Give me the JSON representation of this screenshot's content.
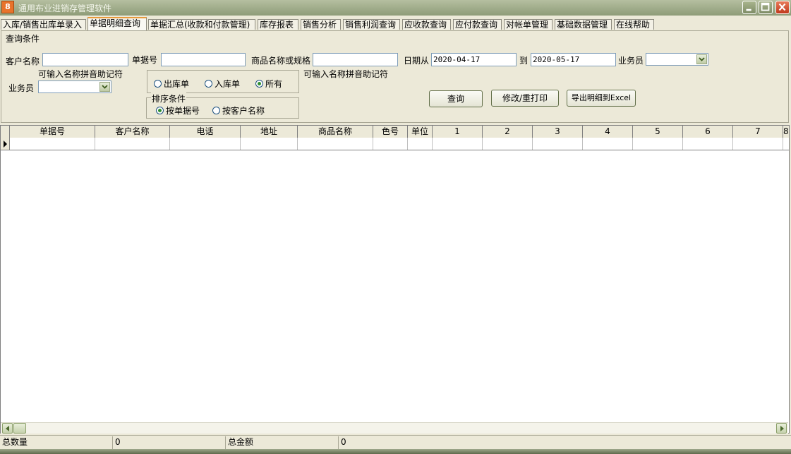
{
  "window": {
    "app_icon": "8",
    "title": "通用布业进销存管理软件"
  },
  "tabs": [
    {
      "label": "入库/销售出库单录入"
    },
    {
      "label": "单据明细查询"
    },
    {
      "label": "单据汇总(收款和付款管理)"
    },
    {
      "label": "库存报表"
    },
    {
      "label": "销售分析"
    },
    {
      "label": "销售利润查询"
    },
    {
      "label": "应收款查询"
    },
    {
      "label": "应付款查询"
    },
    {
      "label": "对帐单管理"
    },
    {
      "label": "基础数据管理"
    },
    {
      "label": "在线帮助"
    }
  ],
  "query": {
    "legend": "查询条件",
    "customer_label": "客户名称",
    "customer_value": "",
    "customer_hint": "可输入名称拼音助记符",
    "doc_no_label": "单据号",
    "doc_no_value": "",
    "product_label": "商品名称或规格",
    "product_value": "",
    "product_hint": "可输入名称拼音助记符",
    "date_from_label": "日期从",
    "date_from": "2020-04-17",
    "date_to_label": "到",
    "date_to": "2020-05-17",
    "salesman_label": "业务员",
    "salesman_value": "",
    "salesman2_label": "业务员",
    "salesman2_value": "",
    "type_options": [
      {
        "label": "出库单",
        "selected": false
      },
      {
        "label": "入库单",
        "selected": false
      },
      {
        "label": "所有",
        "selected": true
      }
    ],
    "sort_legend": "排序条件",
    "sort_options": [
      {
        "label": "按单据号",
        "selected": true
      },
      {
        "label": "按客户名称",
        "selected": false
      }
    ],
    "btn_query": "查询",
    "btn_edit_print": "修改/重打印",
    "btn_export": "导出明细到Excel"
  },
  "grid": {
    "columns": [
      "单据号",
      "客户名称",
      "电话",
      "地址",
      "商品名称",
      "色号",
      "单位",
      "1",
      "2",
      "3",
      "4",
      "5",
      "6",
      "7",
      "8"
    ],
    "rows": [
      [
        "",
        "",
        "",
        "",
        "",
        "",
        "",
        "",
        "",
        "",
        "",
        "",
        "",
        "",
        ""
      ]
    ]
  },
  "status": {
    "total_qty_label": "总数量",
    "total_qty": "0",
    "total_amount_label": "总金额",
    "total_amount": "0"
  }
}
